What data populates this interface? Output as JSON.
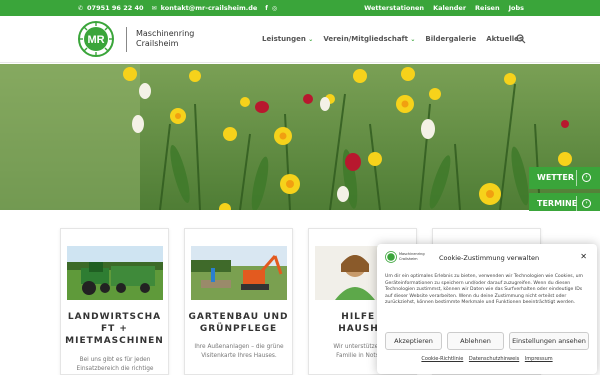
{
  "topbar": {
    "phone": "07951 96 22 40",
    "email": "kontakt@mr-crailsheim.de",
    "links": [
      "Wetterstationen",
      "Kalender",
      "Reisen",
      "Jobs"
    ],
    "bg_color": "#3aa53a"
  },
  "header": {
    "logo_initials": "MR",
    "logo_line1": "Maschinenring",
    "logo_line2": "Crailsheim",
    "nav": [
      "Leistungen",
      "Verein/Mitgliedschaft",
      "Bildergalerie",
      "Aktuelles"
    ],
    "search_icon": "search-icon"
  },
  "side_tabs": [
    "WETTER",
    "TERMINE"
  ],
  "cards": [
    {
      "title_l1": "LANDWIRTSCHA",
      "title_l2": "FT +",
      "title_l3": "MIETMASCHINEN",
      "desc_l1": "Bei uns gibt es für jeden",
      "desc_l2": "Einsatzbereich die richtige"
    },
    {
      "title_l1": "GARTENBAU UND",
      "title_l2": "GRÜNPFLEGE",
      "desc_l1": "Ihre Außenanlagen – die grüne",
      "desc_l2": "Visitenkarte Ihres Hauses."
    },
    {
      "title_l1": "HILFE I",
      "title_l2": "HAUSHA",
      "desc_l1": "Wir unterstützen Sie",
      "desc_l2": "Familie in Notsitua"
    }
  ],
  "cookie": {
    "brand_l1": "Maschinenring",
    "brand_l2": "Crailsheim",
    "title": "Cookie-Zustimmung verwalten",
    "text": "Um dir ein optimales Erlebnis zu bieten, verwenden wir Technologien wie Cookies, um Geräteinformationen zu speichern und/oder darauf zuzugreifen. Wenn du diesen Technologien zustimmst, können wir Daten wie das Surfverhalten oder eindeutige IDs auf dieser Website verarbeiten. Wenn du deine Zustimmung nicht erteilst oder zurückziehst, können bestimmte Merkmale und Funktionen beeinträchtigt werden.",
    "accept": "Akzeptieren",
    "reject": "Ablehnen",
    "settings": "Einstellungen ansehen",
    "links": [
      "Cookie-Richtlinie",
      "Datenschutzhinweis",
      "Impressum"
    ]
  },
  "colors": {
    "accent": "#3aa53a"
  }
}
